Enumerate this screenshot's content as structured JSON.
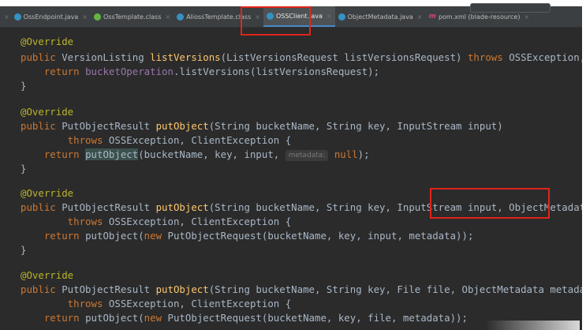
{
  "tabs": [
    {
      "label": "OssEndpoint.java",
      "icon": "java-class-icon",
      "color": "#3592c4",
      "active": false
    },
    {
      "label": "OssTemplate.class",
      "icon": "interface-class-icon",
      "color": "#62b543",
      "active": false
    },
    {
      "label": "AliossTemplate.class",
      "icon": "class-file-icon",
      "color": "#3592c4",
      "active": false
    },
    {
      "label": "OSSClient.java",
      "icon": "java-class-icon",
      "color": "#3592c4",
      "active": true
    },
    {
      "label": "ObjectMetadata.java",
      "icon": "java-class-icon",
      "color": "#3592c4",
      "active": false
    },
    {
      "label": "pom.xml (blade-resource)",
      "icon": "maven-pom-icon",
      "color": "#c7467a",
      "active": false
    }
  ],
  "tab_close_glyph": "×",
  "pom_glyph": "m",
  "code": {
    "l1": {
      "ann": "@Override"
    },
    "l2": {
      "a": "public ",
      "b": "VersionListing ",
      "c": "listVersions",
      "d": "(ListVersionsRequest listVersionsRequest) ",
      "e": "throws ",
      "f": "OSSException, ClientException"
    },
    "l3": {
      "a": "    return ",
      "b": "bucketOperation",
      "c": ".listVersions(listVersionsRequest);"
    },
    "l4": {
      "a": "}"
    },
    "l5": {
      "ann": "@Override"
    },
    "l6": {
      "a": "public ",
      "b": "PutObjectResult ",
      "c": "putObject",
      "d": "(String bucketName, String key, InputStream input)"
    },
    "l7": {
      "a": "        throws ",
      "b": "OSSException, ClientException {"
    },
    "l8": {
      "a": "    return ",
      "b": "putObject",
      "c": "(bucketName, key, input, ",
      "hint": "metadata:",
      "d": " null",
      "e": ");"
    },
    "l9": {
      "a": "}"
    },
    "l10": {
      "ann": "@Override"
    },
    "l11": {
      "a": "public ",
      "b": "PutObjectResult ",
      "c": "putObject",
      "d": "(String bucketName, String key, InputStream input, ",
      "e": "ObjectMetadata metadata",
      "f": ")"
    },
    "l12": {
      "a": "        throws ",
      "b": "OSSException, ClientException {"
    },
    "l13": {
      "a": "    return ",
      "b": "putObject(",
      "c": "new ",
      "d": "PutObjectRequest(bucketName, key, input, metadata));"
    },
    "l14": {
      "a": "}"
    },
    "l15": {
      "ann": "@Override"
    },
    "l16": {
      "a": "public ",
      "b": "PutObjectResult ",
      "c": "putObject",
      "d": "(String bucketName, String key, File file, ObjectMetadata metadata)"
    },
    "l17": {
      "a": "        throws ",
      "b": "OSSException, ClientException {"
    },
    "l18": {
      "a": "    return ",
      "b": "putObject(",
      "c": "new ",
      "d": "PutObjectRequest(bucketName, key, file, metadata));"
    }
  },
  "colors": {
    "background": "#2b2b2b",
    "annotation": "#bbb529",
    "keyword": "#cc7832",
    "method": "#ffc66d",
    "field": "#9876aa",
    "text": "#a9b7c6",
    "highlight_box": "#e0241b"
  }
}
